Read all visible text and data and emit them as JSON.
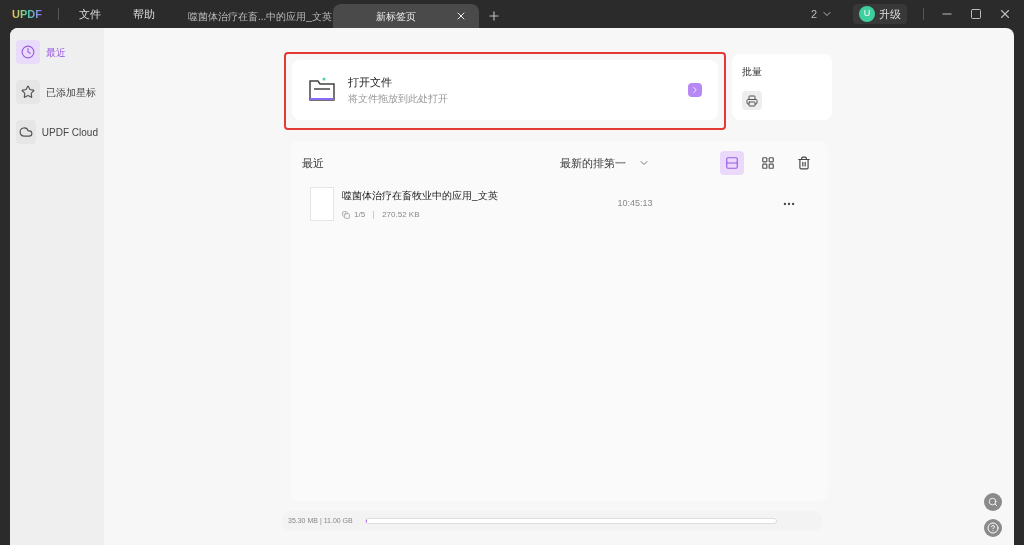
{
  "app": {
    "logo": "UPDF",
    "menu": [
      "文件",
      "帮助"
    ]
  },
  "tabs": [
    {
      "label": "噬菌体治疗在畜...中的应用_文英",
      "selected": false,
      "closable": false
    },
    {
      "label": "新标签页",
      "selected": true,
      "closable": true
    }
  ],
  "window_controls": {
    "count": "2",
    "upgrade": "升级",
    "avatar": "U"
  },
  "sidebar": {
    "items": [
      {
        "label": "最近",
        "selected": true,
        "kind": "clock"
      },
      {
        "label": "已添加星标",
        "selected": false,
        "kind": "star"
      },
      {
        "label": "UPDF Cloud",
        "selected": false,
        "kind": "cloud"
      }
    ]
  },
  "open_file": {
    "title": "打开文件",
    "subtitle": "将文件拖放到此处打开",
    "highlighted": true
  },
  "batch": {
    "title": "批量"
  },
  "recent": {
    "title": "最近",
    "sort": "最新的排第一",
    "views": [
      {
        "kind": "list",
        "selected": true
      },
      {
        "kind": "grid",
        "selected": false
      }
    ],
    "files": [
      {
        "name": "噬菌体治疗在畜牧业中的应用_文英",
        "pages": "1/5",
        "size": "270.52 KB",
        "time": "10:45:13"
      }
    ]
  },
  "storage": {
    "text": "35.30 MB | 11.00 GB",
    "level": 0.003
  }
}
